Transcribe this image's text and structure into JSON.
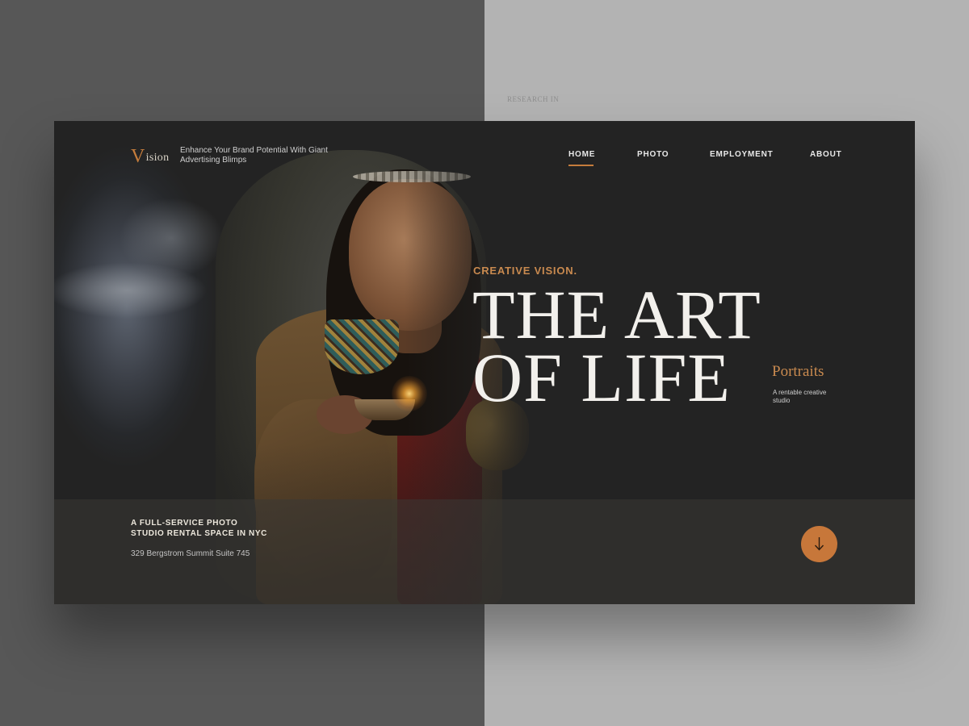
{
  "background": {
    "caption": "RESEARCH IN"
  },
  "brand": {
    "logo_initial": "V",
    "logo_rest": "ision",
    "tagline": "Enhance Your Brand Potential With Giant Advertising Blimps"
  },
  "nav": {
    "items": [
      "HOME",
      "PHOTO",
      "EMPLOYMENT",
      "ABOUT"
    ],
    "active": "HOME"
  },
  "hero": {
    "kicker": "CREATIVE VISION.",
    "title_line1": "THE ART",
    "title_line2": "OF LIFE",
    "side_title": "Portraits",
    "side_subtitle": "A rentable creative studio"
  },
  "footer": {
    "service_line1": "A FULL-SERVICE PHOTO",
    "service_line2": "STUDIO RENTAL SPACE IN NYC",
    "address": "329 Bergstrom Summit Suite 745"
  },
  "colors": {
    "accent": "#c7773a",
    "card_bg": "#232323",
    "text_light": "#f2f0ec"
  },
  "icons": {
    "scroll_down": "arrow-down-icon"
  }
}
